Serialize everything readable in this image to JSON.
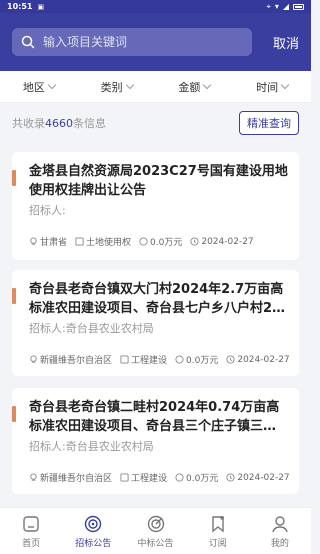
{
  "status": {
    "time": "10:51",
    "left_icon": "notification-icon"
  },
  "search": {
    "placeholder": "输入项目关键词",
    "cancel": "取消"
  },
  "filters": [
    "地区",
    "类别",
    "金额",
    "时间"
  ],
  "count": {
    "prefix": "共收录",
    "number": "4660",
    "suffix": "条信息"
  },
  "precise_button": "精准查询",
  "cards": [
    {
      "title": "金塔县自然资源局2023C27号国有建设用地使用权挂牌出让公告",
      "bidder": "招标人:",
      "region": "甘肃省",
      "category": "土地使用权",
      "amount": "0.0万元",
      "date": "2024-02-27"
    },
    {
      "title": "奇台县老奇台镇双大门村2024年2.7万亩高标准农田建设项目、奇台县七户乡八户村2…",
      "bidder": "招标人:奇台县农业农村局",
      "region": "新疆维吾尔自治区",
      "category": "工程建设",
      "amount": "0.0万元",
      "date": "2024-02-27"
    },
    {
      "title": "奇台县老奇台镇二畦村2024年0.74万亩高标准农田建设项目、奇台县三个庄子镇三…",
      "bidder": "招标人:奇台县农业农村局",
      "region": "新疆维吾尔自治区",
      "category": "工程建设",
      "amount": "0.0万元",
      "date": "2024-02-27"
    }
  ],
  "tabs": [
    "首页",
    "招标公告",
    "中标公告",
    "订阅",
    "我的"
  ],
  "colors": {
    "primary": "#3a3e9f",
    "accent": "#e08a5c"
  }
}
